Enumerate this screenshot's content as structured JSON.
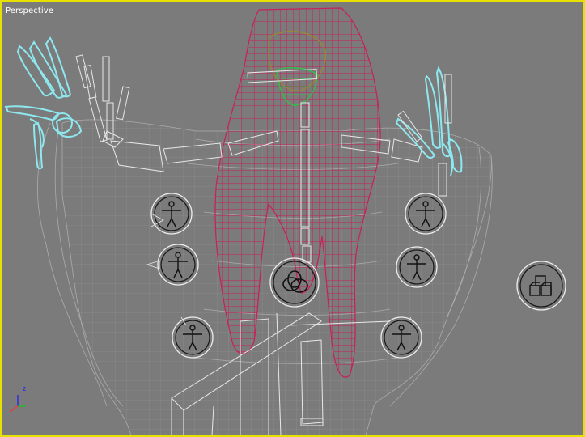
{
  "viewport": {
    "label": "Perspective",
    "border_color": "#e8e000",
    "background": "#7b7b7b"
  },
  "colors": {
    "hair": "#c8205a",
    "hands": "#8de8f0",
    "body_wire": "#b8b8b8",
    "bones": "#e8e8e8",
    "head_green": "#2fbf4a",
    "head_olive": "#9a8a2a"
  },
  "helpers": {
    "biped_icon": "biped-figure-icon",
    "ring_icon": "rings-icon",
    "box_icon": "boxes-icon"
  },
  "axis": {
    "z_label": "z",
    "x_label": "x"
  }
}
